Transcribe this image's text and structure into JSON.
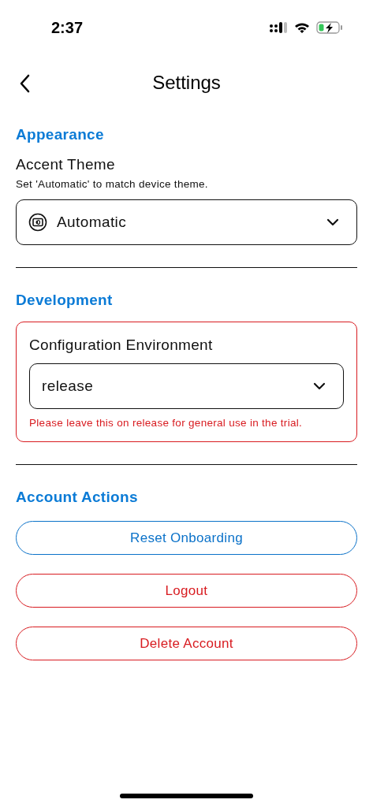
{
  "status_bar": {
    "time": "2:37"
  },
  "nav": {
    "title": "Settings"
  },
  "appearance": {
    "heading": "Appearance",
    "label": "Accent Theme",
    "hint": "Set 'Automatic' to match device theme.",
    "select": {
      "value": "Automatic"
    }
  },
  "development": {
    "heading": "Development",
    "label": "Configuration Environment",
    "select": {
      "value": "release"
    },
    "warning": "Please leave this on release for general use in the trial."
  },
  "account": {
    "heading": "Account Actions",
    "buttons": [
      {
        "label": "Reset Onboarding",
        "kind": "default"
      },
      {
        "label": "Logout",
        "kind": "destructive"
      },
      {
        "label": "Delete Account",
        "kind": "destructive"
      }
    ]
  }
}
